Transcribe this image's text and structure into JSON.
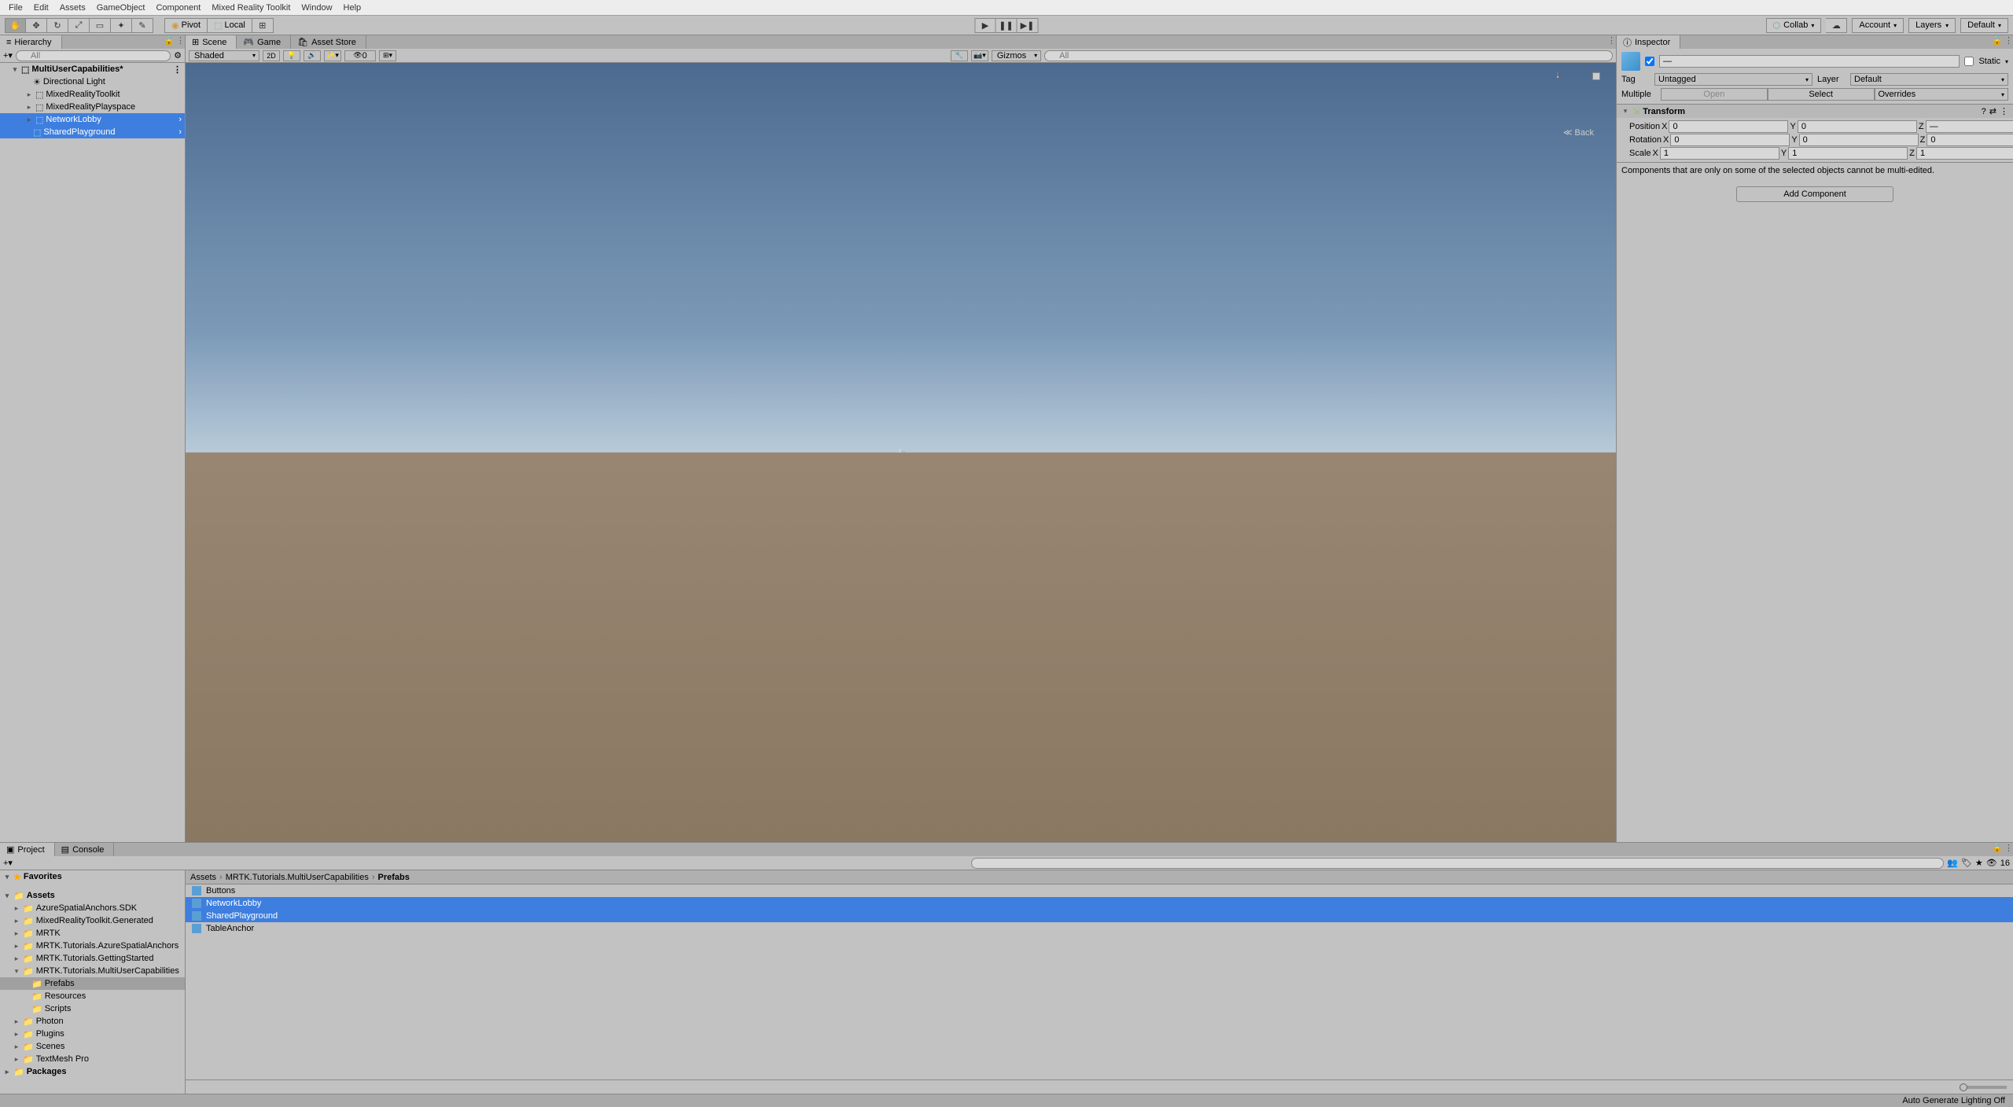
{
  "menu": [
    "File",
    "Edit",
    "Assets",
    "GameObject",
    "Component",
    "Mixed Reality Toolkit",
    "Window",
    "Help"
  ],
  "toolbar": {
    "pivot": "Pivot",
    "local": "Local",
    "collab": "Collab",
    "account": "Account",
    "layers": "Layers",
    "layout": "Default"
  },
  "hierarchy": {
    "title": "Hierarchy",
    "search_placeholder": "All",
    "scene": "MultiUserCapabilities*",
    "items": [
      {
        "name": "Directional Light",
        "indent": 1,
        "selected": false
      },
      {
        "name": "MixedRealityToolkit",
        "indent": 1,
        "selected": false,
        "fold": true
      },
      {
        "name": "MixedRealityPlayspace",
        "indent": 1,
        "selected": false,
        "fold": true
      },
      {
        "name": "NetworkLobby",
        "indent": 1,
        "selected": true,
        "fold": true,
        "arrow": true
      },
      {
        "name": "SharedPlayground",
        "indent": 1,
        "selected": true,
        "arrow": true
      }
    ]
  },
  "scene": {
    "tabs": [
      "Scene",
      "Game",
      "Asset Store"
    ],
    "shaded": "Shaded",
    "mode2d": "2D",
    "gizmos": "Gizmos",
    "search_placeholder": "All",
    "back": "Back",
    "hidden_count": "0"
  },
  "inspector": {
    "title": "Inspector",
    "name": "—",
    "static": "Static",
    "tag_label": "Tag",
    "tag_value": "Untagged",
    "layer_label": "Layer",
    "layer_value": "Default",
    "multiple": "Multiple",
    "open": "Open",
    "select": "Select",
    "overrides": "Overrides",
    "transform": {
      "title": "Transform",
      "position": {
        "label": "Position",
        "x": "0",
        "y": "0",
        "z": "—"
      },
      "rotation": {
        "label": "Rotation",
        "x": "0",
        "y": "0",
        "z": "0"
      },
      "scale": {
        "label": "Scale",
        "x": "1",
        "y": "1",
        "z": "1"
      }
    },
    "warning": "Components that are only on some of the selected objects cannot be multi-edited.",
    "add_component": "Add Component"
  },
  "project": {
    "title": "Project",
    "console": "Console",
    "favorites": "Favorites",
    "assets": "Assets",
    "packages": "Packages",
    "tree": [
      {
        "name": "AzureSpatialAnchors.SDK",
        "indent": 1
      },
      {
        "name": "MixedRealityToolkit.Generated",
        "indent": 1
      },
      {
        "name": "MRTK",
        "indent": 1
      },
      {
        "name": "MRTK.Tutorials.AzureSpatialAnchors",
        "indent": 1
      },
      {
        "name": "MRTK.Tutorials.GettingStarted",
        "indent": 1
      },
      {
        "name": "MRTK.Tutorials.MultiUserCapabilities",
        "indent": 1,
        "open": true
      },
      {
        "name": "Prefabs",
        "indent": 2,
        "selected": true
      },
      {
        "name": "Resources",
        "indent": 2
      },
      {
        "name": "Scripts",
        "indent": 2
      },
      {
        "name": "Photon",
        "indent": 1
      },
      {
        "name": "Plugins",
        "indent": 1
      },
      {
        "name": "Scenes",
        "indent": 1
      },
      {
        "name": "TextMesh Pro",
        "indent": 1
      }
    ],
    "breadcrumb": [
      "Assets",
      "MRTK.Tutorials.MultiUserCapabilities",
      "Prefabs"
    ],
    "assets_list": [
      {
        "name": "Buttons",
        "selected": false
      },
      {
        "name": "NetworkLobby",
        "selected": true
      },
      {
        "name": "SharedPlayground",
        "selected": true
      },
      {
        "name": "TableAnchor",
        "selected": false
      }
    ],
    "slider_count": "16"
  },
  "status": "Auto Generate Lighting Off"
}
